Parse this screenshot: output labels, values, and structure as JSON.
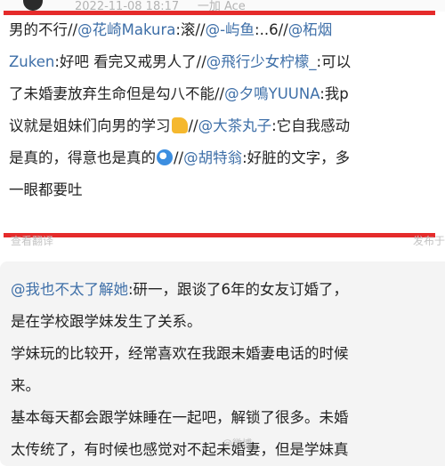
{
  "header": {
    "timestamp": "2022-11-08 18:17",
    "author": "一加 Ace"
  },
  "highlighted": {
    "lines": [
      [
        {
          "t": "男的不行//"
        },
        {
          "t": "@花崎Makura",
          "m": true
        },
        {
          "t": ":滚//"
        },
        {
          "t": "@-屿鱼",
          "m": true
        },
        {
          "t": ":..6//"
        },
        {
          "t": "@柘烟",
          "m": true
        }
      ],
      [
        {
          "t": "Zuken",
          "m": true
        },
        {
          "t": ":好吧 看完又戒男人了//"
        },
        {
          "t": "@飛行少女柠檬_",
          "m": true
        },
        {
          "t": ":可以"
        }
      ],
      [
        {
          "t": "了未婚妻放弃生命但是勾八不能//"
        },
        {
          "t": "@夕鳴YUUNA",
          "m": true
        },
        {
          "t": ":我p"
        }
      ],
      [
        {
          "t": "议就是姐妹们向男的学习"
        },
        {
          "e": "thumbs"
        },
        {
          "t": "//"
        },
        {
          "t": "@大茶丸子",
          "m": true
        },
        {
          "t": ":它自我感动"
        }
      ],
      [
        {
          "t": "是真的，得意也是真的"
        },
        {
          "e": "dizzy"
        },
        {
          "t": "//"
        },
        {
          "t": "@胡特翁",
          "m": true
        },
        {
          "t": ":好脏的文字，多"
        }
      ],
      [
        {
          "t": "一眼都要吐"
        }
      ]
    ]
  },
  "sub": {
    "left": "查看翻译",
    "right": "发布于"
  },
  "card": {
    "lines": [
      [
        {
          "t": "@我也不太了解她",
          "m": true
        },
        {
          "t": ":研一，跟谈了6年的女友订婚了，"
        }
      ],
      [
        {
          "t": "是在学校跟学妹发生了关系。"
        }
      ],
      [
        {
          "t": "学妹玩的比较开，经常喜欢在我跟未婚妻电话的时候"
        }
      ],
      [
        {
          "t": "来。"
        }
      ],
      [
        {
          "t": "基本每天都会跟学妹睡在一起吧，解锁了很多。未婚"
        }
      ],
      [
        {
          "t": "太传统了，有时候也感觉对不起未婚妻，但是学妹真"
        }
      ]
    ]
  },
  "watermark": "@微博"
}
